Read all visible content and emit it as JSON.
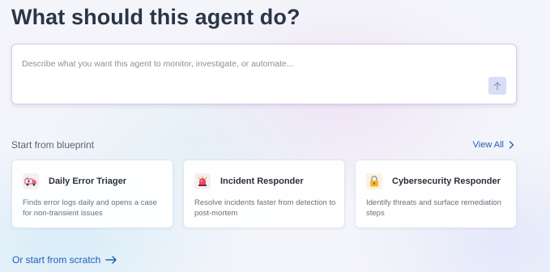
{
  "heading": "What should this agent do?",
  "prompt": {
    "placeholder": "Describe what you want this agent to monitor, investigate, or automate...",
    "submit_icon": "arrow-up-icon"
  },
  "blueprints": {
    "section_label": "Start from blueprint",
    "view_all": "View All",
    "cards": [
      {
        "title": "Daily Error Triager",
        "description": "Finds error logs daily and opens a case for non-transient issues",
        "icon": "ambulance-icon"
      },
      {
        "title": "Incident Responder",
        "description": "Resolve incidents faster from detection to post-mortem",
        "icon": "siren-icon"
      },
      {
        "title": "Cybersecurity Responder",
        "description": "Identify threats and surface remediation steps",
        "icon": "lock-icon"
      }
    ]
  },
  "scratch_link": "Or start from scratch",
  "colors": {
    "accent": "#1f5fb4",
    "heading": "#2a3645",
    "submit_bg": "#d7def7",
    "input_border": "#d9c7ea"
  }
}
